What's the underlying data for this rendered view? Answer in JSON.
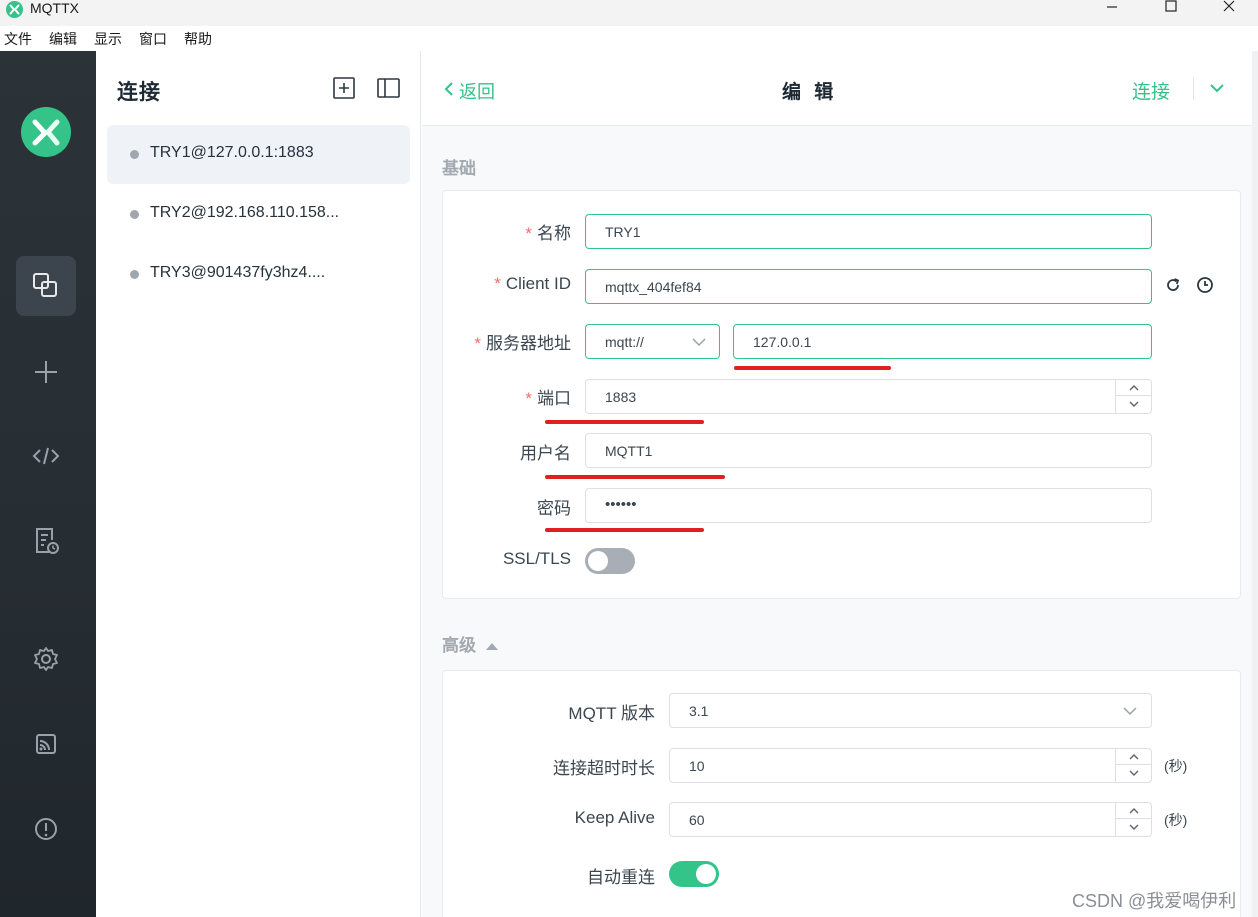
{
  "window": {
    "title": "MQTTX"
  },
  "menubar": {
    "items": [
      "文件",
      "编辑",
      "显示",
      "窗口",
      "帮助"
    ]
  },
  "rail": {
    "logo_icon": "mqttx-logo-icon",
    "items": [
      {
        "name": "connections",
        "icon": "connections-icon",
        "active": true
      },
      {
        "name": "new-connection",
        "icon": "plus-icon",
        "active": false
      },
      {
        "name": "script",
        "icon": "code-icon",
        "active": false
      },
      {
        "name": "log",
        "icon": "log-icon",
        "active": false
      },
      {
        "name": "settings",
        "icon": "gear-icon",
        "active": false
      },
      {
        "name": "subscriptions",
        "icon": "feed-icon",
        "active": false
      },
      {
        "name": "about",
        "icon": "info-icon",
        "active": false
      }
    ]
  },
  "connections": {
    "title": "连接",
    "items": [
      {
        "label": "TRY1@127.0.0.1:1883",
        "active": true
      },
      {
        "label": "TRY2@192.168.110.158...",
        "active": false
      },
      {
        "label": "TRY3@901437fy3hz4....",
        "active": false
      }
    ]
  },
  "topbar": {
    "back_label": "返回",
    "title": "编 辑",
    "connect_label": "连接"
  },
  "basic": {
    "section_title": "基础",
    "name": {
      "label": "名称",
      "value": "TRY1"
    },
    "client_id": {
      "label": "Client ID",
      "value": "mqttx_404fef84"
    },
    "host": {
      "label": "服务器地址",
      "protocol": "mqtt://",
      "value": "127.0.0.1"
    },
    "port": {
      "label": "端口",
      "value": "1883"
    },
    "username": {
      "label": "用户名",
      "value": "MQTT1"
    },
    "password": {
      "label": "密码",
      "value": "••••••"
    },
    "ssl": {
      "label": "SSL/TLS",
      "enabled": false
    }
  },
  "advanced": {
    "section_title": "高级",
    "mqtt_version": {
      "label": "MQTT 版本",
      "value": "3.1"
    },
    "connect_timeout": {
      "label": "连接超时时长",
      "value": "10",
      "unit": "(秒)"
    },
    "keep_alive": {
      "label": "Keep Alive",
      "value": "60",
      "unit": "(秒)"
    },
    "auto_reconnect": {
      "label": "自动重连",
      "enabled": true
    }
  },
  "watermark": "CSDN @我爱喝伊利",
  "colors": {
    "accent": "#34c388",
    "required": "#f56c6c",
    "annotation": "#e02020",
    "rail": "#2b3339"
  }
}
